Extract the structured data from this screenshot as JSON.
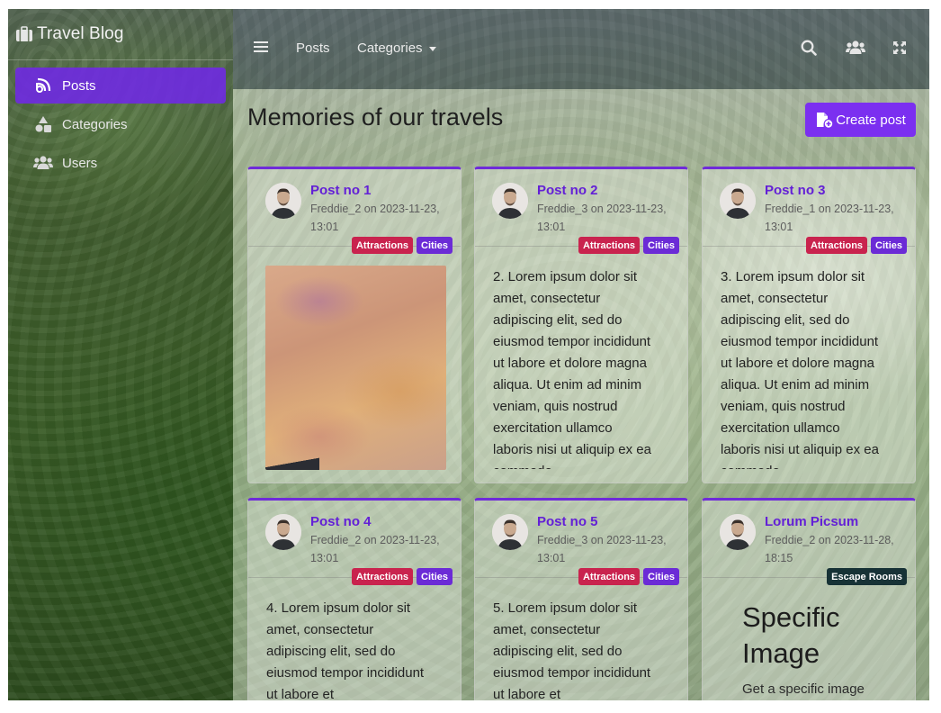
{
  "app": {
    "brand": "Travel Blog"
  },
  "sidebar": {
    "items": [
      {
        "label": "Posts",
        "icon": "blog-icon",
        "active": true
      },
      {
        "label": "Categories",
        "icon": "shapes-icon",
        "active": false
      },
      {
        "label": "Users",
        "icon": "users-icon",
        "active": false
      }
    ]
  },
  "topbar": {
    "posts_label": "Posts",
    "categories_label": "Categories"
  },
  "main": {
    "title": "Memories of our travels",
    "create_label": "Create post"
  },
  "posts": [
    {
      "title": "Post no 1",
      "meta": "Freddie_2 on 2023-11-23, 13:01",
      "badges": [
        "Attractions",
        "Cities"
      ],
      "excerpt": ""
    },
    {
      "title": "Post no 2",
      "meta": "Freddie_3 on 2023-11-23, 13:01",
      "badges": [
        "Attractions",
        "Cities"
      ],
      "excerpt": "2. Lorem ipsum dolor sit amet, consectetur adipiscing elit, sed do eiusmod tempor incididunt ut labore et dolore magna aliqua. Ut enim ad minim veniam, quis nostrud exercitation ullamco laboris nisi ut aliquip ex ea commodo"
    },
    {
      "title": "Post no 3",
      "meta": "Freddie_1 on 2023-11-23, 13:01",
      "badges": [
        "Attractions",
        "Cities"
      ],
      "excerpt": "3. Lorem ipsum dolor sit amet, consectetur adipiscing elit, sed do eiusmod tempor incididunt ut labore et dolore magna aliqua. Ut enim ad minim veniam, quis nostrud exercitation ullamco laboris nisi ut aliquip ex ea commodo"
    },
    {
      "title": "Post no 4",
      "meta": "Freddie_2 on 2023-11-23, 13:01",
      "badges": [
        "Attractions",
        "Cities"
      ],
      "excerpt": "4. Lorem ipsum dolor sit amet, consectetur adipiscing elit, sed do eiusmod tempor incididunt ut labore et"
    },
    {
      "title": "Post no 5",
      "meta": "Freddie_3 on 2023-11-23, 13:01",
      "badges": [
        "Attractions",
        "Cities"
      ],
      "excerpt": "5. Lorem ipsum dolor sit amet, consectetur adipiscing elit, sed do eiusmod tempor incididunt ut labore et"
    },
    {
      "title": "Lorum Picsum",
      "meta": "Freddie_2 on 2023-11-28, 18:15",
      "badges": [
        "Escape Rooms"
      ],
      "heading": "Specific Image",
      "excerpt": "Get a specific image by"
    }
  ],
  "colors": {
    "accent": "#7b2ff0",
    "title_link": "#6320d6",
    "badge_attractions": "#c9234e",
    "badge_cities": "#6b2bd6",
    "badge_escape": "#173236"
  }
}
